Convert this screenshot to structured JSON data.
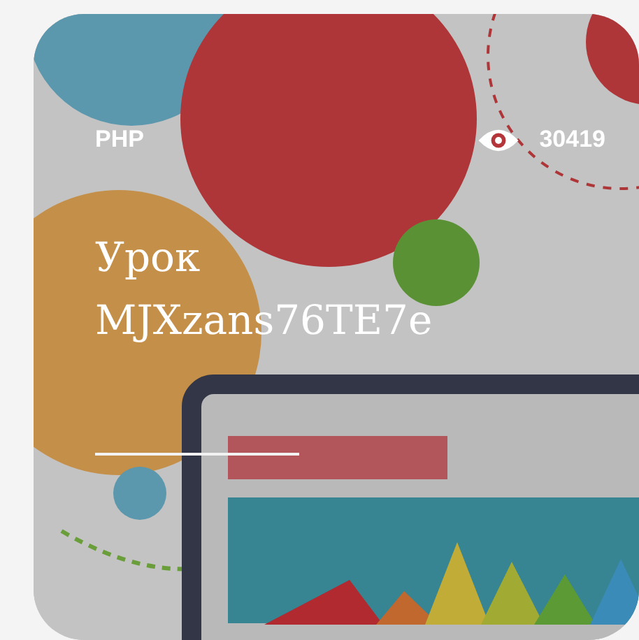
{
  "card": {
    "category": "PHP",
    "views": "30419",
    "title": "Урок MJXzans76TE7e"
  }
}
